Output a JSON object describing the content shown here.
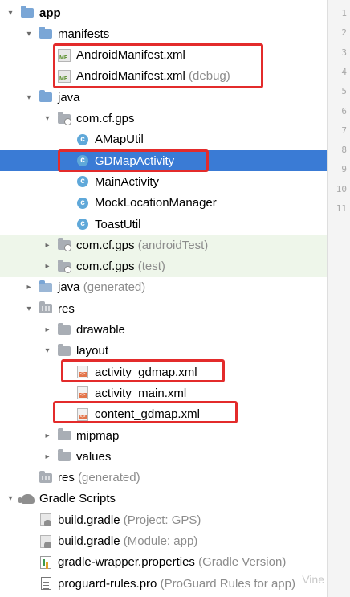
{
  "tree": [
    {
      "label": "app",
      "bold": true,
      "arrow": "▾",
      "icon": "folder-icon",
      "indent": 0
    },
    {
      "label": "manifests",
      "arrow": "▾",
      "icon": "folder-icon",
      "indent": 1
    },
    {
      "label": "AndroidManifest.xml",
      "icon": "manifest-file-icon",
      "indent": 2
    },
    {
      "label": "AndroidManifest.xml",
      "hint": "(debug)",
      "icon": "manifest-file-icon",
      "indent": 2
    },
    {
      "label": "java",
      "arrow": "▾",
      "icon": "folder-icon",
      "indent": 1
    },
    {
      "label": "com.cf.gps",
      "arrow": "▾",
      "icon": "package-icon",
      "indent": 2
    },
    {
      "label": "AMapUtil",
      "icon": "class-icon",
      "indent": 3
    },
    {
      "label": "GDMapActivity",
      "icon": "class-icon",
      "indent": 3,
      "selected": true
    },
    {
      "label": "MainActivity",
      "icon": "class-icon",
      "indent": 3
    },
    {
      "label": "MockLocationManager",
      "icon": "class-icon",
      "indent": 3
    },
    {
      "label": "ToastUtil",
      "icon": "class-icon",
      "indent": 3
    },
    {
      "label": "com.cf.gps",
      "hint": "(androidTest)",
      "arrow": "▸",
      "icon": "package-icon",
      "indent": 2,
      "green": true
    },
    {
      "label": "com.cf.gps",
      "hint": "(test)",
      "arrow": "▸",
      "icon": "package-icon",
      "indent": 2,
      "green": true
    },
    {
      "label": "java",
      "hint": "(generated)",
      "arrow": "▸",
      "icon": "generated-folder-icon",
      "indent": 1
    },
    {
      "label": "res",
      "arrow": "▾",
      "icon": "resource-folder-icon",
      "indent": 1
    },
    {
      "label": "drawable",
      "arrow": "▸",
      "icon": "gray-folder-icon",
      "indent": 2
    },
    {
      "label": "layout",
      "arrow": "▾",
      "icon": "gray-folder-icon",
      "indent": 2
    },
    {
      "label": "activity_gdmap.xml",
      "icon": "layout-xml-icon",
      "indent": 3
    },
    {
      "label": "activity_main.xml",
      "icon": "layout-xml-icon",
      "indent": 3
    },
    {
      "label": "content_gdmap.xml",
      "icon": "layout-xml-icon",
      "indent": 3
    },
    {
      "label": "mipmap",
      "arrow": "▸",
      "icon": "gray-folder-icon",
      "indent": 2
    },
    {
      "label": "values",
      "arrow": "▸",
      "icon": "gray-folder-icon",
      "indent": 2
    },
    {
      "label": "res",
      "hint": "(generated)",
      "icon": "resource-folder-icon",
      "indent": 1
    },
    {
      "label": "Gradle Scripts",
      "arrow": "▾",
      "icon": "gradle-icon",
      "indent": 0
    },
    {
      "label": "build.gradle",
      "hint": "(Project: GPS)",
      "icon": "gradle-file-icon",
      "indent": 1
    },
    {
      "label": "build.gradle",
      "hint": "(Module: app)",
      "icon": "gradle-file-icon",
      "indent": 1
    },
    {
      "label": "gradle-wrapper.properties",
      "hint": "(Gradle Version)",
      "icon": "properties-file-icon",
      "indent": 1
    },
    {
      "label": "proguard-rules.pro",
      "hint": "(ProGuard Rules for app)",
      "icon": "text-file-icon",
      "indent": 1
    }
  ],
  "line_numbers": [
    "1",
    "2",
    "3",
    "4",
    "5",
    "6",
    "7",
    "8",
    "9",
    "10",
    "11"
  ],
  "watermark": "Vine",
  "colors": {
    "selection": "#3a7bd5",
    "highlight_box": "#e32b2b",
    "test_bg": "#eef6ea"
  }
}
